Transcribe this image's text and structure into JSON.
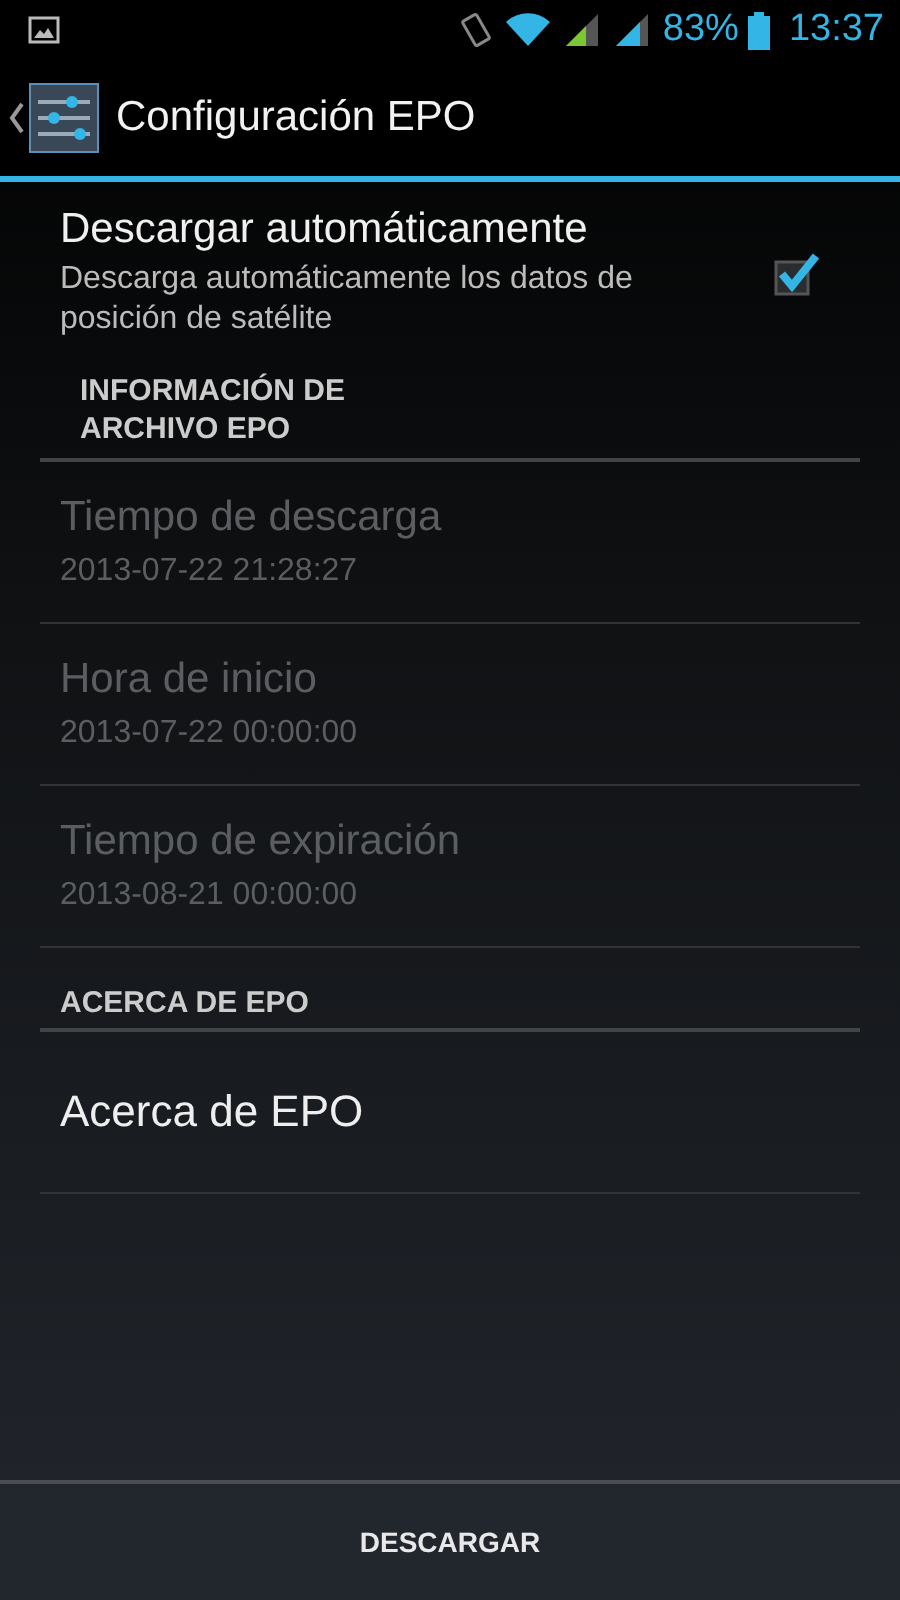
{
  "status_bar": {
    "battery": "83%",
    "time": "13:37"
  },
  "action_bar": {
    "title": "Configuración EPO"
  },
  "preferences": [
    {
      "kind": "checkbox",
      "title": "Descargar automáticamente",
      "summary": "Descarga automáticamente los datos de posición de satélite",
      "checked": true
    },
    {
      "kind": "header",
      "title": "INFORMACIÓN DE ARCHIVO EPO"
    },
    {
      "kind": "item",
      "title": "Tiempo de descarga",
      "summary": "2013-07-22 21:28:27",
      "disabled": true
    },
    {
      "kind": "item",
      "title": "Hora de inicio",
      "summary": "2013-07-22 00:00:00",
      "disabled": true
    },
    {
      "kind": "item",
      "title": "Tiempo de expiración",
      "summary": "2013-08-21 00:00:00",
      "disabled": true
    },
    {
      "kind": "header",
      "title": "ACERCA DE EPO"
    },
    {
      "kind": "item",
      "title": "Acerca de EPO",
      "disabled": false
    }
  ],
  "button": "DESCARGAR"
}
